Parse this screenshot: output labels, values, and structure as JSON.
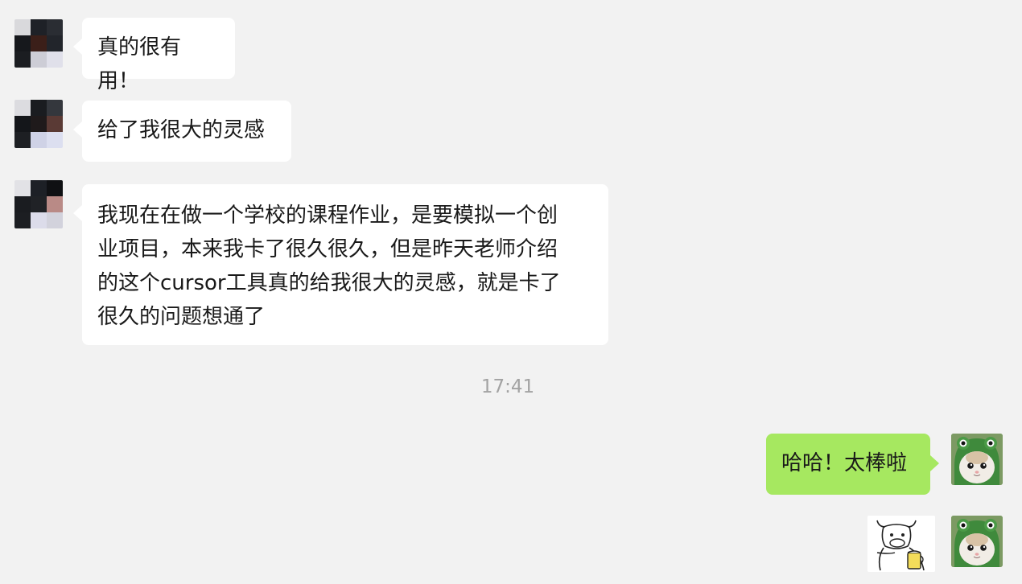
{
  "chat": {
    "incoming": [
      {
        "text": "真的很有用！"
      },
      {
        "text": "给了我很大的灵感"
      },
      {
        "lines": [
          "我现在在做一个学校的课程作业，是要模拟一个创",
          "业项目，本来我卡了很久很久，但是昨天老师介绍",
          "的这个cursor工具真的给我很大的灵感，就是卡了",
          "很久的问题想通了"
        ]
      }
    ],
    "timestamp": "17:41",
    "outgoing": [
      {
        "text": "哈哈！太棒啦"
      }
    ]
  },
  "colors": {
    "background": "#f2f2f2",
    "incoming_bubble": "#ffffff",
    "outgoing_bubble": "#a6e860",
    "timestamp": "#a3a3a3"
  },
  "icons": {
    "sender_avatar": "pixelated-avatar-icon",
    "self_avatar": "cat-frog-hat-avatar-icon",
    "sticker": "cow-beer-sticker-icon"
  }
}
